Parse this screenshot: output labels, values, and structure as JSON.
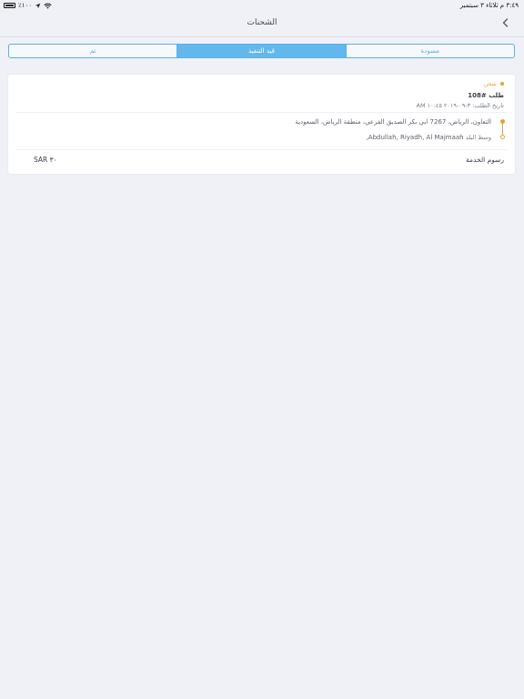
{
  "status_bar": {
    "battery": "٪١٠٠",
    "datetime": "٣:٤٩ م   ثلاثاء ٣ سبتمبر"
  },
  "navbar": {
    "title": "الشحنات"
  },
  "segments": [
    {
      "label": "مسودة",
      "active": false
    },
    {
      "label": "قيد التنفيذ",
      "active": true
    },
    {
      "label": "تم",
      "active": false
    }
  ],
  "order": {
    "status": "شحن",
    "number": "طلب #108",
    "date": "تاريخ الطلب: ٣-٠٩-٢٠١٩ ١٠:٤٥ AM",
    "from_address": "التعاون، الرياض، 7267 ابي بكر الصديق الفرعي، منطقة الرياض، السعودية",
    "to_label": "وسط البلد",
    "to_address": "Abdullah, Riyadh, Al Majmaah,",
    "fee_label": "رسوم الخدمة",
    "fee_value": "SAR ٣٠"
  },
  "colors": {
    "accent": "#5ab0e8",
    "status": "#e0a43a",
    "background": "#eff1f6"
  }
}
